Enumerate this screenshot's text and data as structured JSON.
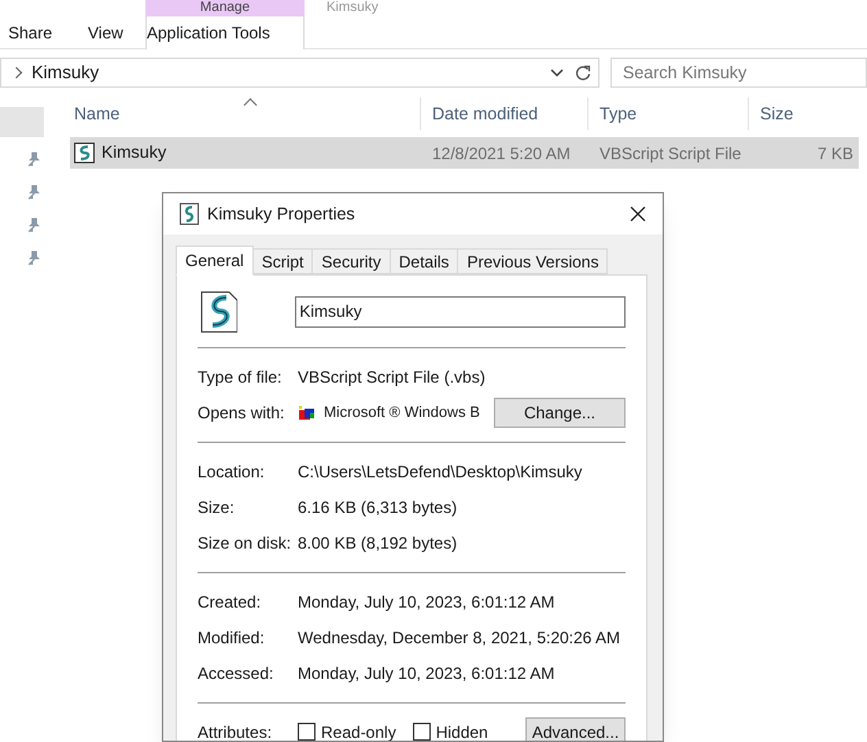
{
  "ribbon": {
    "context_group": "Manage",
    "window_title": "Kimsuky",
    "tabs": [
      {
        "label": "Share",
        "selected": false
      },
      {
        "label": "View",
        "selected": false
      },
      {
        "label": "Application Tools",
        "selected": true
      }
    ]
  },
  "address_bar": {
    "path": "Kimsuky"
  },
  "search": {
    "placeholder": "Search Kimsuky"
  },
  "file_list": {
    "columns": [
      {
        "label": "Name",
        "sorted": true
      },
      {
        "label": "Date modified",
        "sorted": false
      },
      {
        "label": "Type",
        "sorted": false
      },
      {
        "label": "Size",
        "sorted": false
      }
    ],
    "rows": [
      {
        "name": "Kimsuky",
        "date_modified": "12/8/2021 5:20 AM",
        "type": "VBScript Script File",
        "size": "7 KB",
        "selected": true
      }
    ]
  },
  "dialog": {
    "title": "Kimsuky Properties",
    "tabs": [
      {
        "label": "General",
        "selected": true
      },
      {
        "label": "Script",
        "selected": false
      },
      {
        "label": "Security",
        "selected": false
      },
      {
        "label": "Details",
        "selected": false
      },
      {
        "label": "Previous Versions",
        "selected": false
      }
    ],
    "file_name": "Kimsuky",
    "groups": [
      [
        {
          "kind": "text",
          "label": "Type of file:",
          "value": "VBScript Script File (.vbs)"
        },
        {
          "kind": "app",
          "label": "Opens with:",
          "value": "Microsoft ® Windows B",
          "button": "Change..."
        }
      ],
      [
        {
          "kind": "text",
          "label": "Location:",
          "value": "C:\\Users\\LetsDefend\\Desktop\\Kimsuky"
        },
        {
          "kind": "text",
          "label": "Size:",
          "value": "6.16 KB (6,313 bytes)"
        },
        {
          "kind": "text",
          "label": "Size on disk:",
          "value": "8.00 KB (8,192 bytes)"
        }
      ],
      [
        {
          "kind": "text",
          "label": "Created:",
          "value": "Monday, July 10, 2023, 6:01:12 AM"
        },
        {
          "kind": "text",
          "label": "Modified:",
          "value": "Wednesday, December 8, 2021, 5:20:26 AM"
        },
        {
          "kind": "text",
          "label": "Accessed:",
          "value": "Monday, July 10, 2023, 6:01:12 AM"
        }
      ]
    ],
    "attributes": {
      "label": "Attributes:",
      "checkboxes": [
        {
          "label": "Read-only",
          "checked": false
        },
        {
          "label": "Hidden",
          "checked": false
        }
      ],
      "button": "Advanced..."
    }
  }
}
